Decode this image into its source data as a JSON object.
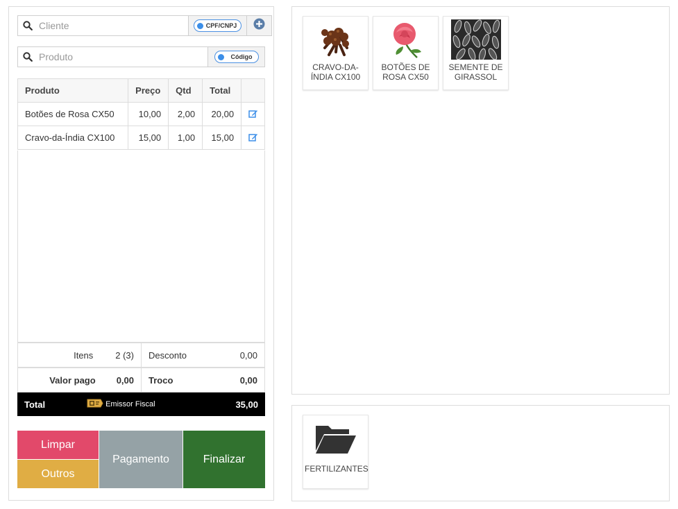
{
  "search": {
    "client_placeholder": "Cliente",
    "client_toggle": "CPF/CNPJ",
    "product_placeholder": "Produto",
    "product_toggle": "Código"
  },
  "cart": {
    "headers": [
      "Produto",
      "Preço",
      "Qtd",
      "Total"
    ],
    "rows": [
      {
        "product": "Botões de Rosa CX50",
        "price": "10,00",
        "qty": "2,00",
        "total": "20,00"
      },
      {
        "product": "Cravo-da-Índia CX100",
        "price": "15,00",
        "qty": "1,00",
        "total": "15,00"
      }
    ]
  },
  "summary": {
    "items_label": "Itens",
    "items_value": "2 (3)",
    "discount_label": "Desconto",
    "discount_value": "0,00",
    "paid_label": "Valor pago",
    "paid_value": "0,00",
    "change_label": "Troco",
    "change_value": "0,00",
    "total_label": "Total",
    "fiscal_label": "Emissor Fiscal",
    "total_value": "35,00"
  },
  "actions": {
    "clear": "Limpar",
    "others": "Outros",
    "payment": "Pagamento",
    "finish": "Finalizar"
  },
  "products": [
    {
      "name": "CRAVO-DA-ÍNDIA CX100",
      "icon": "cloves-image"
    },
    {
      "name": "BOTÕES DE ROSA CX50",
      "icon": "rose-image"
    },
    {
      "name": "SEMENTE DE GIRASSOL",
      "icon": "sunflower-seeds-image"
    }
  ],
  "categories": [
    {
      "name": "FERTILIZANTES",
      "icon": "folder-open-icon"
    }
  ],
  "colors": {
    "clear": "#e2496a",
    "others": "#e0ad44",
    "payment": "#95a2a6",
    "finish": "#31722f",
    "accent": "#3b8ee8"
  }
}
